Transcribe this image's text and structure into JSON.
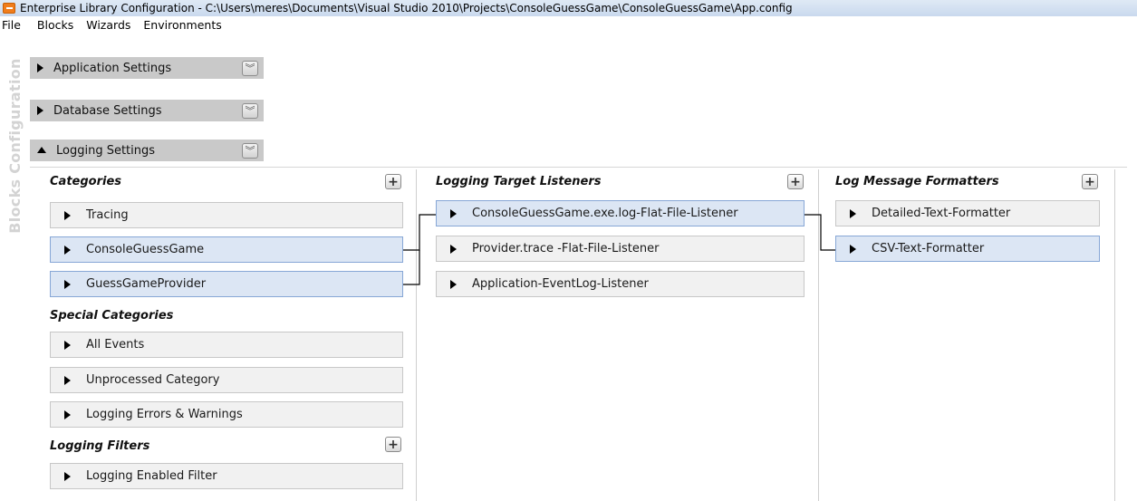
{
  "window": {
    "title": "Enterprise Library Configuration - C:\\Users\\meres\\Documents\\Visual Studio 2010\\Projects\\ConsoleGuessGame\\ConsoleGuessGame\\App.config",
    "icon": "app-icon"
  },
  "menu": [
    "File",
    "Blocks",
    "Wizards",
    "Environments"
  ],
  "sidebar_label": "Blocks Configuration",
  "sections": {
    "application": "Application Settings",
    "database": "Database Settings",
    "logging": "Logging Settings"
  },
  "columns": {
    "categories": {
      "title": "Categories",
      "items": [
        "Tracing",
        "ConsoleGuessGame",
        "GuessGameProvider"
      ]
    },
    "special_categories": {
      "title": "Special Categories",
      "items": [
        "All Events",
        "Unprocessed Category",
        "Logging Errors & Warnings"
      ]
    },
    "logging_filters": {
      "title": "Logging Filters",
      "items": [
        "Logging Enabled Filter"
      ]
    },
    "listeners": {
      "title": "Logging Target Listeners",
      "items": [
        "ConsoleGuessGame.exe.log-Flat-File-Listener",
        "Provider.trace -Flat-File-Listener",
        "Application-EventLog-Listener"
      ]
    },
    "formatters": {
      "title": "Log Message Formatters",
      "items": [
        "Detailed-Text-Formatter",
        "CSV-Text-Formatter"
      ]
    }
  },
  "selection": {
    "categories": [
      "ConsoleGuessGame",
      "GuessGameProvider"
    ],
    "listener": "ConsoleGuessGame.exe.log-Flat-File-Listener",
    "formatter": "CSV-Text-Formatter"
  },
  "colors": {
    "selected_bg": "#dce6f4",
    "selected_border": "#87a7d6",
    "item_bg": "#f1f1f1",
    "section_header_bg": "#c9c9c9"
  }
}
